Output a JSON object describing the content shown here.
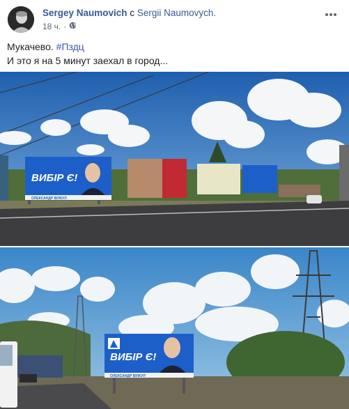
{
  "post": {
    "author": "Sergey Naumovich",
    "connector": "с",
    "coauthor": "Sergii Naumovych.",
    "time": "18 ч.",
    "separator": "·",
    "privacy_icon": "globe-icon",
    "more_icon": "ellipsis-icon",
    "text_line1_prefix": "Мукачево.",
    "hashtag": "#Пздц",
    "text_line2": "И это я на 5 минут заехал в город..."
  },
  "photos": {
    "billboard_slogan": "ВИБІР Є!",
    "billboard_name": "ОЛЕКСАНДР ВІЛКУЛ"
  },
  "colors": {
    "link": "#385898",
    "text": "#1c1e21",
    "meta": "#616770",
    "billboard_blue": "#1d5fc8"
  }
}
